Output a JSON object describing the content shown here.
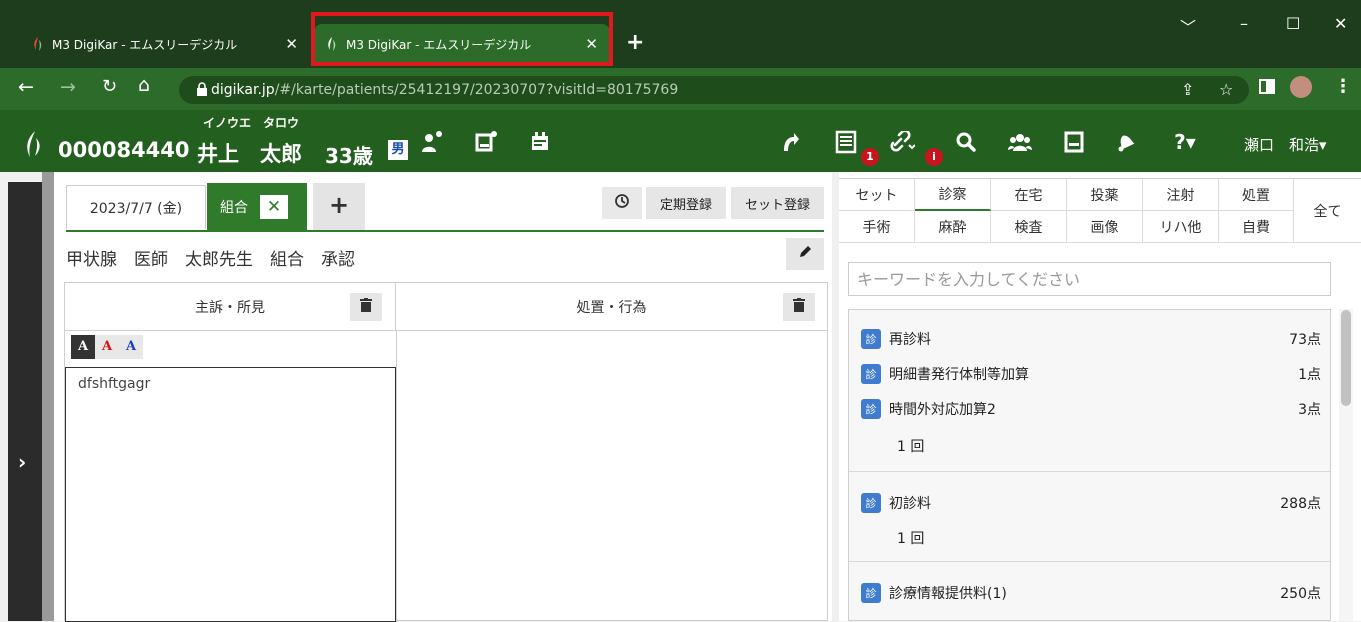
{
  "browser": {
    "tabs": [
      {
        "title": "M3 DigiKar - エムスリーデジカル",
        "active": false
      },
      {
        "title": "M3 DigiKar - エムスリーデジカル",
        "active": true
      }
    ],
    "url_host": "digikar.jp",
    "url_path": "/#/karte/patients/25412197/20230707?visitId=80175769"
  },
  "header": {
    "patient_id": "000084440",
    "furigana": "イノウエ　タロウ",
    "name": "井上　太郎",
    "age": "33歳",
    "sex": "男",
    "badge1": "1",
    "badge2": "i",
    "doctor": "瀬口　和浩▾"
  },
  "karte": {
    "date": "2023/7/7 (金)",
    "active_tab": "組合",
    "close_tab": "✕",
    "add_tab": "+",
    "periodic_label": "定期登録",
    "set_label": "セット登録",
    "title_line": "甲状腺　医師　太郎先生　組合　承認",
    "col_left": "主訴・所見",
    "col_right": "処置・行為",
    "color_buttons": [
      "A",
      "A",
      "A"
    ],
    "left_text": "dfshftgagr"
  },
  "right": {
    "categories_row1": [
      "セット",
      "診察",
      "在宅",
      "投薬",
      "注射",
      "処置"
    ],
    "categories_row2": [
      "手術",
      "麻酔",
      "検査",
      "画像",
      "リハ他",
      "自費"
    ],
    "cat_all": "全て",
    "active_category": "診察",
    "keyword_placeholder": "キーワードを入力してください",
    "icon_label": "診",
    "groups": [
      {
        "items": [
          {
            "name": "再診料",
            "points": "73点"
          },
          {
            "name": "明細書発行体制等加算",
            "points": "1点"
          },
          {
            "name": "時間外対応加算2",
            "points": "3点"
          }
        ],
        "times": "1 回"
      },
      {
        "items": [
          {
            "name": "初診料",
            "points": "288点"
          }
        ],
        "times": "1 回"
      },
      {
        "items": [
          {
            "name": "診療情報提供料(1)",
            "points": "250点"
          }
        ],
        "times": ""
      }
    ]
  }
}
